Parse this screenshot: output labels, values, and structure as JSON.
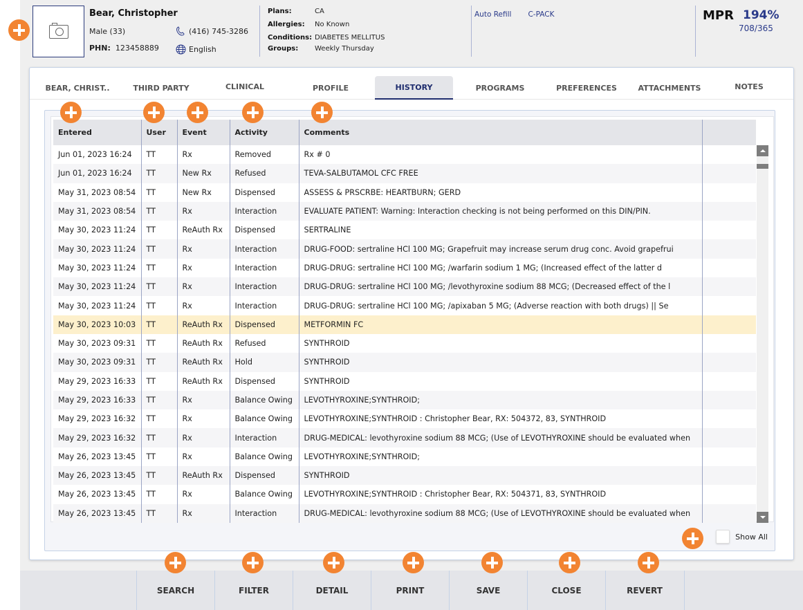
{
  "patient": {
    "name": "Bear, Christopher",
    "gender_age": "Male (33)",
    "phn_label": "PHN:",
    "phn": "123458889",
    "phone": "(416) 745-3286",
    "language": "English"
  },
  "info": {
    "plans_label": "Plans:",
    "plans": "CA",
    "allergies_label": "Allergies:",
    "allergies": "No Known",
    "conditions_label": "Conditions:",
    "conditions": "DIABETES MELLITUS",
    "groups_label": "Groups:",
    "groups": "Weekly Thursday"
  },
  "links": [
    "Auto Refill",
    "C-PACK"
  ],
  "mpr": {
    "label": "MPR",
    "percent": "194%",
    "ratio": "708/365"
  },
  "tabs": [
    {
      "label": "BEAR, CHRIST.."
    },
    {
      "label": "THIRD PARTY"
    },
    {
      "label": "CLINICAL"
    },
    {
      "label": "PROFILE"
    },
    {
      "label": "HISTORY",
      "active": true
    },
    {
      "label": "PROGRAMS"
    },
    {
      "label": "PREFERENCES"
    },
    {
      "label": "ATTACHMENTS"
    },
    {
      "label": "NOTES"
    }
  ],
  "table": {
    "columns": [
      "Entered",
      "User",
      "Event",
      "Activity",
      "Comments",
      ""
    ],
    "selected_row": 9,
    "rows": [
      [
        "Jun 01, 2023 16:24",
        "TT",
        "Rx",
        "Removed",
        "Rx # 0"
      ],
      [
        "Jun 01, 2023 16:24",
        "TT",
        "New Rx",
        "Refused",
        "TEVA-SALBUTAMOL CFC FREE"
      ],
      [
        "May 31, 2023 08:54",
        "TT",
        "New Rx",
        "Dispensed",
        "ASSESS & PRSCRBE: HEARTBURN; GERD"
      ],
      [
        "May 31, 2023 08:54",
        "TT",
        "Rx",
        "Interaction",
        "EVALUATE PATIENT: Warning: Interaction checking is not being performed on this DIN/PIN."
      ],
      [
        "May 30, 2023 11:24",
        "TT",
        "ReAuth Rx",
        "Dispensed",
        "SERTRALINE"
      ],
      [
        "May 30, 2023 11:24",
        "TT",
        "Rx",
        "Interaction",
        "DRUG-FOOD: sertraline HCl 100 MG; Grapefruit may increase serum drug conc. Avoid grapefrui"
      ],
      [
        "May 30, 2023 11:24",
        "TT",
        "Rx",
        "Interaction",
        "DRUG-DRUG: sertraline HCl 100 MG; /warfarin sodium 1 MG; (Increased effect of the latter d"
      ],
      [
        "May 30, 2023 11:24",
        "TT",
        "Rx",
        "Interaction",
        "DRUG-DRUG: sertraline HCl 100 MG; /levothyroxine sodium 88 MCG; (Decreased effect of the l"
      ],
      [
        "May 30, 2023 11:24",
        "TT",
        "Rx",
        "Interaction",
        "DRUG-DRUG: sertraline HCl 100 MG; /apixaban 5 MG; (Adverse reaction with both drugs) || Se"
      ],
      [
        "May 30, 2023 10:03",
        "TT",
        "ReAuth Rx",
        "Dispensed",
        "METFORMIN FC"
      ],
      [
        "May 30, 2023 09:31",
        "TT",
        "ReAuth Rx",
        "Refused",
        "SYNTHROID"
      ],
      [
        "May 30, 2023 09:31",
        "TT",
        "ReAuth Rx",
        "Hold",
        "SYNTHROID"
      ],
      [
        "May 29, 2023 16:33",
        "TT",
        "ReAuth Rx",
        "Dispensed",
        "SYNTHROID"
      ],
      [
        "May 29, 2023 16:33",
        "TT",
        "Rx",
        "Balance Owing",
        "LEVOTHYROXINE;SYNTHROID;"
      ],
      [
        "May 29, 2023 16:32",
        "TT",
        "Rx",
        "Balance Owing",
        "LEVOTHYROXINE;SYNTHROID : Christopher Bear, RX: 504372, 83, SYNTHROID"
      ],
      [
        "May 29, 2023 16:32",
        "TT",
        "Rx",
        "Interaction",
        "DRUG-MEDICAL: levothyroxine sodium 88 MCG; (Use of LEVOTHYROXINE should be evaluated when"
      ],
      [
        "May 26, 2023 13:45",
        "TT",
        "Rx",
        "Balance Owing",
        "LEVOTHYROXINE;SYNTHROID;"
      ],
      [
        "May 26, 2023 13:45",
        "TT",
        "ReAuth Rx",
        "Dispensed",
        "SYNTHROID"
      ],
      [
        "May 26, 2023 13:45",
        "TT",
        "Rx",
        "Balance Owing",
        "LEVOTHYROXINE;SYNTHROID : Christopher Bear, RX: 504371, 83, SYNTHROID"
      ],
      [
        "May 26, 2023 13:45",
        "TT",
        "Rx",
        "Interaction",
        "DRUG-MEDICAL: levothyroxine sodium 88 MCG; (Use of LEVOTHYROXINE should be evaluated when"
      ]
    ]
  },
  "show_all": {
    "label": "Show All",
    "checked": false
  },
  "toolbar": {
    "buttons": [
      "SEARCH",
      "FILTER",
      "DETAIL",
      "PRINT",
      "SAVE",
      "CLOSE",
      "REVERT"
    ]
  },
  "colors": {
    "accent": "#1f2d6e",
    "link": "#2a3a8a",
    "selected_row": "#fdf0cc",
    "marker": "#f28432"
  }
}
